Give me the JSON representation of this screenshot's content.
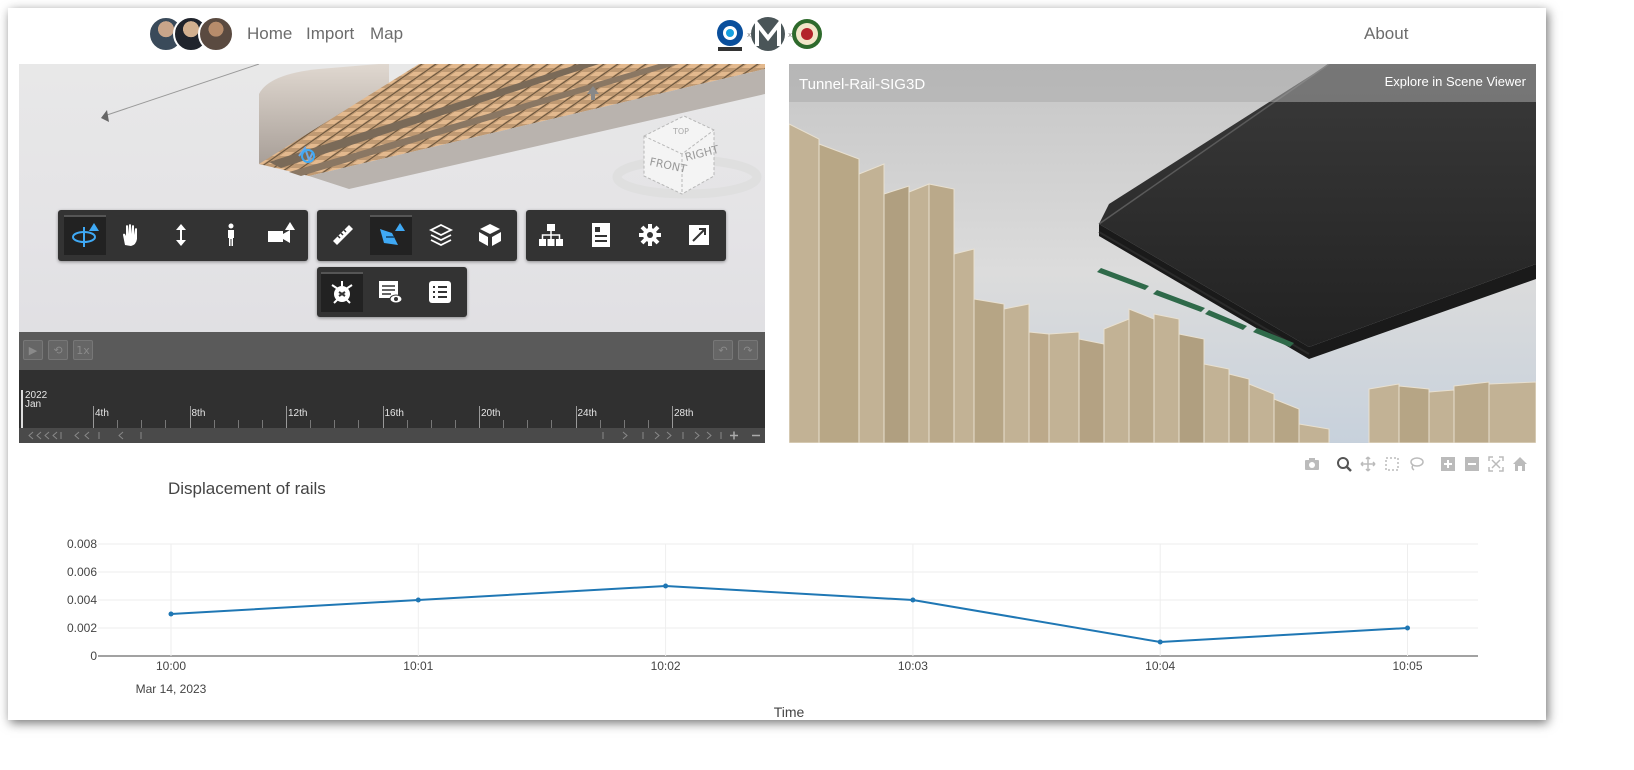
{
  "nav": {
    "links": [
      "Home",
      "Import",
      "Map"
    ],
    "about": "About"
  },
  "cesium": {
    "compass_labels": [
      "FRONT",
      "RIGHT",
      "TOP"
    ],
    "speed": "1x",
    "timeline": {
      "year": "2022",
      "month": "Jan",
      "ticks": [
        "4th",
        "8th",
        "12th",
        "16th",
        "20th",
        "24th",
        "28th"
      ]
    },
    "toolbar_icons": [
      "orbit-icon",
      "pan-hand-icon",
      "vertical-move-icon",
      "walk-icon",
      "camera-icon",
      "ruler-icon",
      "section-icon",
      "layers-icon",
      "cube-icon",
      "model-tree-icon",
      "properties-icon",
      "settings-icon",
      "fullscreen-icon",
      "clash-icon",
      "views-icon",
      "list-icon"
    ],
    "accent_color": "#3fa9f5"
  },
  "scene_viewer": {
    "title": "Tunnel-Rail-SIG3D",
    "explore": "Explore in Scene Viewer"
  },
  "chart_data": {
    "type": "line",
    "title": "Displacement of rails",
    "xlabel": "Time",
    "ylabel": "",
    "x": [
      "10:00",
      "10:01",
      "10:02",
      "10:03",
      "10:04",
      "10:05"
    ],
    "x_date_label": "Mar 14, 2023",
    "series": [
      {
        "values": [
          0.003,
          0.004,
          0.005,
          0.004,
          0.001,
          0.002
        ]
      }
    ],
    "yticks": [
      "0",
      "0.002",
      "0.004",
      "0.006",
      "0.008"
    ],
    "ylim": [
      0,
      0.008
    ],
    "color": "#1f77b4",
    "grid": true
  }
}
